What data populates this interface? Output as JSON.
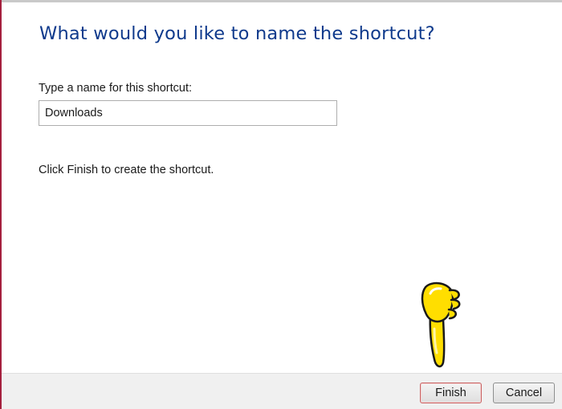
{
  "wizard": {
    "title": "What would you like to name the shortcut?",
    "name_label": "Type a name for this shortcut:",
    "name_value": "Downloads",
    "instruction": "Click Finish to create the shortcut."
  },
  "buttons": {
    "finish_label": "Finish",
    "cancel_label": "Cancel"
  },
  "annotation": {
    "icon": "pointing-down-hand-icon",
    "color": "#ffde00"
  },
  "colors": {
    "title": "#0f3a8c",
    "left_accent": "#a5203e",
    "footer_bg": "#f0f0f0"
  }
}
